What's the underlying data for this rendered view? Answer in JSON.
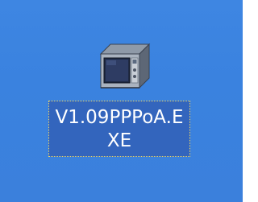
{
  "desktop": {
    "background_color": "#3b82de",
    "icons": [
      {
        "icon": "microwave-oven-icon",
        "label_line1": "V1.09PPPoA.E",
        "label_line2": "XE",
        "selected": true,
        "selection_color": "#3365bd"
      }
    ]
  }
}
